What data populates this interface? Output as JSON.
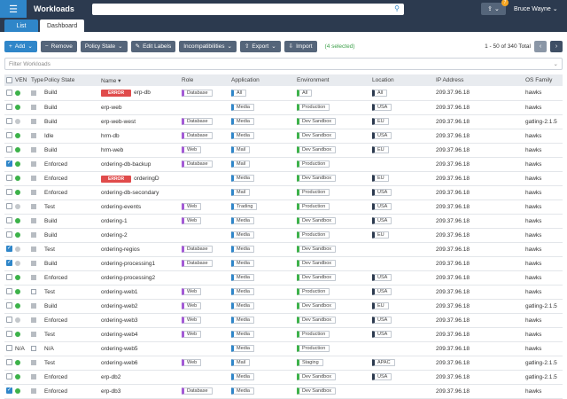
{
  "header": {
    "title": "Workloads",
    "search_placeholder": "",
    "notification_count": "7",
    "user_name": "Bruce Wayne"
  },
  "tabs": [
    {
      "label": "List",
      "active": true
    },
    {
      "label": "Dashboard",
      "active": false
    }
  ],
  "toolbar": {
    "add_label": "Add",
    "remove_label": "Remove",
    "policy_state_label": "Policy State",
    "edit_labels_label": "Edit Labels",
    "incompatibilities_label": "Incompatibilities",
    "export_label": "Export",
    "import_label": "Import",
    "selected_text": "(4 selected)",
    "pager_text": "1 - 50 of 340 Total"
  },
  "filter": {
    "placeholder": "Filter Workloads"
  },
  "columns": [
    "VEN",
    "Type",
    "Policy State",
    "Name ▾",
    "Role",
    "Application",
    "Environment",
    "Location",
    "IP Address",
    "OS Family"
  ],
  "rows": [
    {
      "checked": false,
      "ven": "green",
      "type": "s",
      "policy": "Build",
      "error": "ERROR",
      "name": "erp-db",
      "role": "Database",
      "app": "All",
      "env": "All",
      "loc": "All",
      "ip": "209.37.96.18",
      "os": "hawks"
    },
    {
      "checked": false,
      "ven": "green",
      "type": "s",
      "policy": "Build",
      "error": "",
      "name": "erp-web",
      "role": "",
      "app": "Media",
      "env": "Production",
      "loc": "USA",
      "ip": "209.37.96.18",
      "os": "hawks"
    },
    {
      "checked": false,
      "ven": "grey",
      "type": "s",
      "policy": "Build",
      "error": "",
      "name": "erp-web-west",
      "role": "Database",
      "app": "Media",
      "env": "Dev Sandbox",
      "loc": "EU",
      "ip": "209.37.96.18",
      "os": "gatling-2.1.5"
    },
    {
      "checked": false,
      "ven": "green",
      "type": "s",
      "policy": "Idle",
      "error": "",
      "name": "hrm-db",
      "role": "Database",
      "app": "Media",
      "env": "Dev Sandbox",
      "loc": "USA",
      "ip": "209.37.96.18",
      "os": "hawks"
    },
    {
      "checked": false,
      "ven": "green",
      "type": "s",
      "policy": "Build",
      "error": "",
      "name": "hrm-web",
      "role": "Web",
      "app": "Mail",
      "env": "Dev Sandbox",
      "loc": "EU",
      "ip": "209.37.96.18",
      "os": "hawks"
    },
    {
      "checked": true,
      "ven": "green",
      "type": "s",
      "policy": "Enforced",
      "error": "",
      "name": "ordering-db-backup",
      "role": "Database",
      "app": "Mail",
      "env": "Production",
      "loc": "",
      "ip": "209.37.96.18",
      "os": "hawks"
    },
    {
      "checked": false,
      "ven": "green",
      "type": "s",
      "policy": "Enforced",
      "error": "ERROR",
      "name": "orderingD",
      "role": "",
      "app": "Media",
      "env": "Dev Sandbox",
      "loc": "EU",
      "ip": "209.37.96.18",
      "os": "hawks"
    },
    {
      "checked": false,
      "ven": "green",
      "type": "s",
      "policy": "Enforced",
      "error": "",
      "name": "ordering-db-secondary",
      "role": "",
      "app": "Mail",
      "env": "Production",
      "loc": "USA",
      "ip": "209.37.96.18",
      "os": "hawks"
    },
    {
      "checked": false,
      "ven": "grey",
      "type": "s",
      "policy": "Test",
      "error": "",
      "name": "ordering-events",
      "role": "Web",
      "app": "Trading",
      "env": "Production",
      "loc": "USA",
      "ip": "209.37.96.18",
      "os": "hawks"
    },
    {
      "checked": false,
      "ven": "green",
      "type": "s",
      "policy": "Build",
      "error": "",
      "name": "ordering-1",
      "role": "Web",
      "app": "Media",
      "env": "Dev Sandbox",
      "loc": "USA",
      "ip": "209.37.96.18",
      "os": "hawks"
    },
    {
      "checked": false,
      "ven": "green",
      "type": "s",
      "policy": "Build",
      "error": "",
      "name": "ordering-2",
      "role": "",
      "app": "Media",
      "env": "Production",
      "loc": "EU",
      "ip": "209.37.96.18",
      "os": "hawks"
    },
    {
      "checked": true,
      "ven": "grey",
      "type": "s",
      "policy": "Test",
      "error": "",
      "name": "ordering-regios",
      "role": "Database",
      "app": "Media",
      "env": "Dev Sandbox",
      "loc": "",
      "ip": "209.37.96.18",
      "os": "hawks"
    },
    {
      "checked": true,
      "ven": "grey",
      "type": "s",
      "policy": "Build",
      "error": "",
      "name": "ordering-processing1",
      "role": "Database",
      "app": "Media",
      "env": "Dev Sandbox",
      "loc": "",
      "ip": "209.37.96.18",
      "os": "hawks"
    },
    {
      "checked": false,
      "ven": "green",
      "type": "s",
      "policy": "Enforced",
      "error": "",
      "name": "ordering-processing2",
      "role": "",
      "app": "Media",
      "env": "Dev Sandbox",
      "loc": "USA",
      "ip": "209.37.96.18",
      "os": "hawks"
    },
    {
      "checked": false,
      "ven": "green",
      "type": "v",
      "policy": "Test",
      "error": "",
      "name": "ordering-web1",
      "role": "Web",
      "app": "Media",
      "env": "Production",
      "loc": "USA",
      "ip": "209.37.96.18",
      "os": "hawks"
    },
    {
      "checked": false,
      "ven": "green",
      "type": "s",
      "policy": "Build",
      "error": "",
      "name": "ordering-web2",
      "role": "Web",
      "app": "Media",
      "env": "Dev Sandbox",
      "loc": "EU",
      "ip": "209.37.96.18",
      "os": "gatling-2.1.5"
    },
    {
      "checked": false,
      "ven": "grey",
      "type": "s",
      "policy": "Enforced",
      "error": "",
      "name": "ordering-web3",
      "role": "Web",
      "app": "Media",
      "env": "Dev Sandbox",
      "loc": "USA",
      "ip": "209.37.96.18",
      "os": "hawks"
    },
    {
      "checked": false,
      "ven": "green",
      "type": "s",
      "policy": "Test",
      "error": "",
      "name": "ordering-web4",
      "role": "Web",
      "app": "Media",
      "env": "Production",
      "loc": "USA",
      "ip": "209.37.96.18",
      "os": "hawks"
    },
    {
      "checked": false,
      "ven": "N/A",
      "type": "v",
      "policy": "N/A",
      "error": "",
      "name": "ordering-web5",
      "role": "",
      "app": "Media",
      "env": "Production",
      "loc": "",
      "ip": "209.37.96.18",
      "os": "hawks"
    },
    {
      "checked": false,
      "ven": "green",
      "type": "s",
      "policy": "Test",
      "error": "",
      "name": "ordering-web6",
      "role": "Web",
      "app": "Mail",
      "env": "Staging",
      "loc": "APAC",
      "ip": "209.37.96.18",
      "os": "gatling-2.1.5"
    },
    {
      "checked": false,
      "ven": "green",
      "type": "s",
      "policy": "Enforced",
      "error": "",
      "name": "erp-db2",
      "role": "",
      "app": "Media",
      "env": "Dev Sandbox",
      "loc": "USA",
      "ip": "209.37.96.18",
      "os": "gatling-2.1.5"
    },
    {
      "checked": true,
      "ven": "green",
      "type": "s",
      "policy": "Enforced",
      "error": "",
      "name": "erp-db3",
      "role": "Database",
      "app": "Media",
      "env": "Dev Sandbox",
      "loc": "",
      "ip": "209.37.96.18",
      "os": "hawks"
    }
  ]
}
